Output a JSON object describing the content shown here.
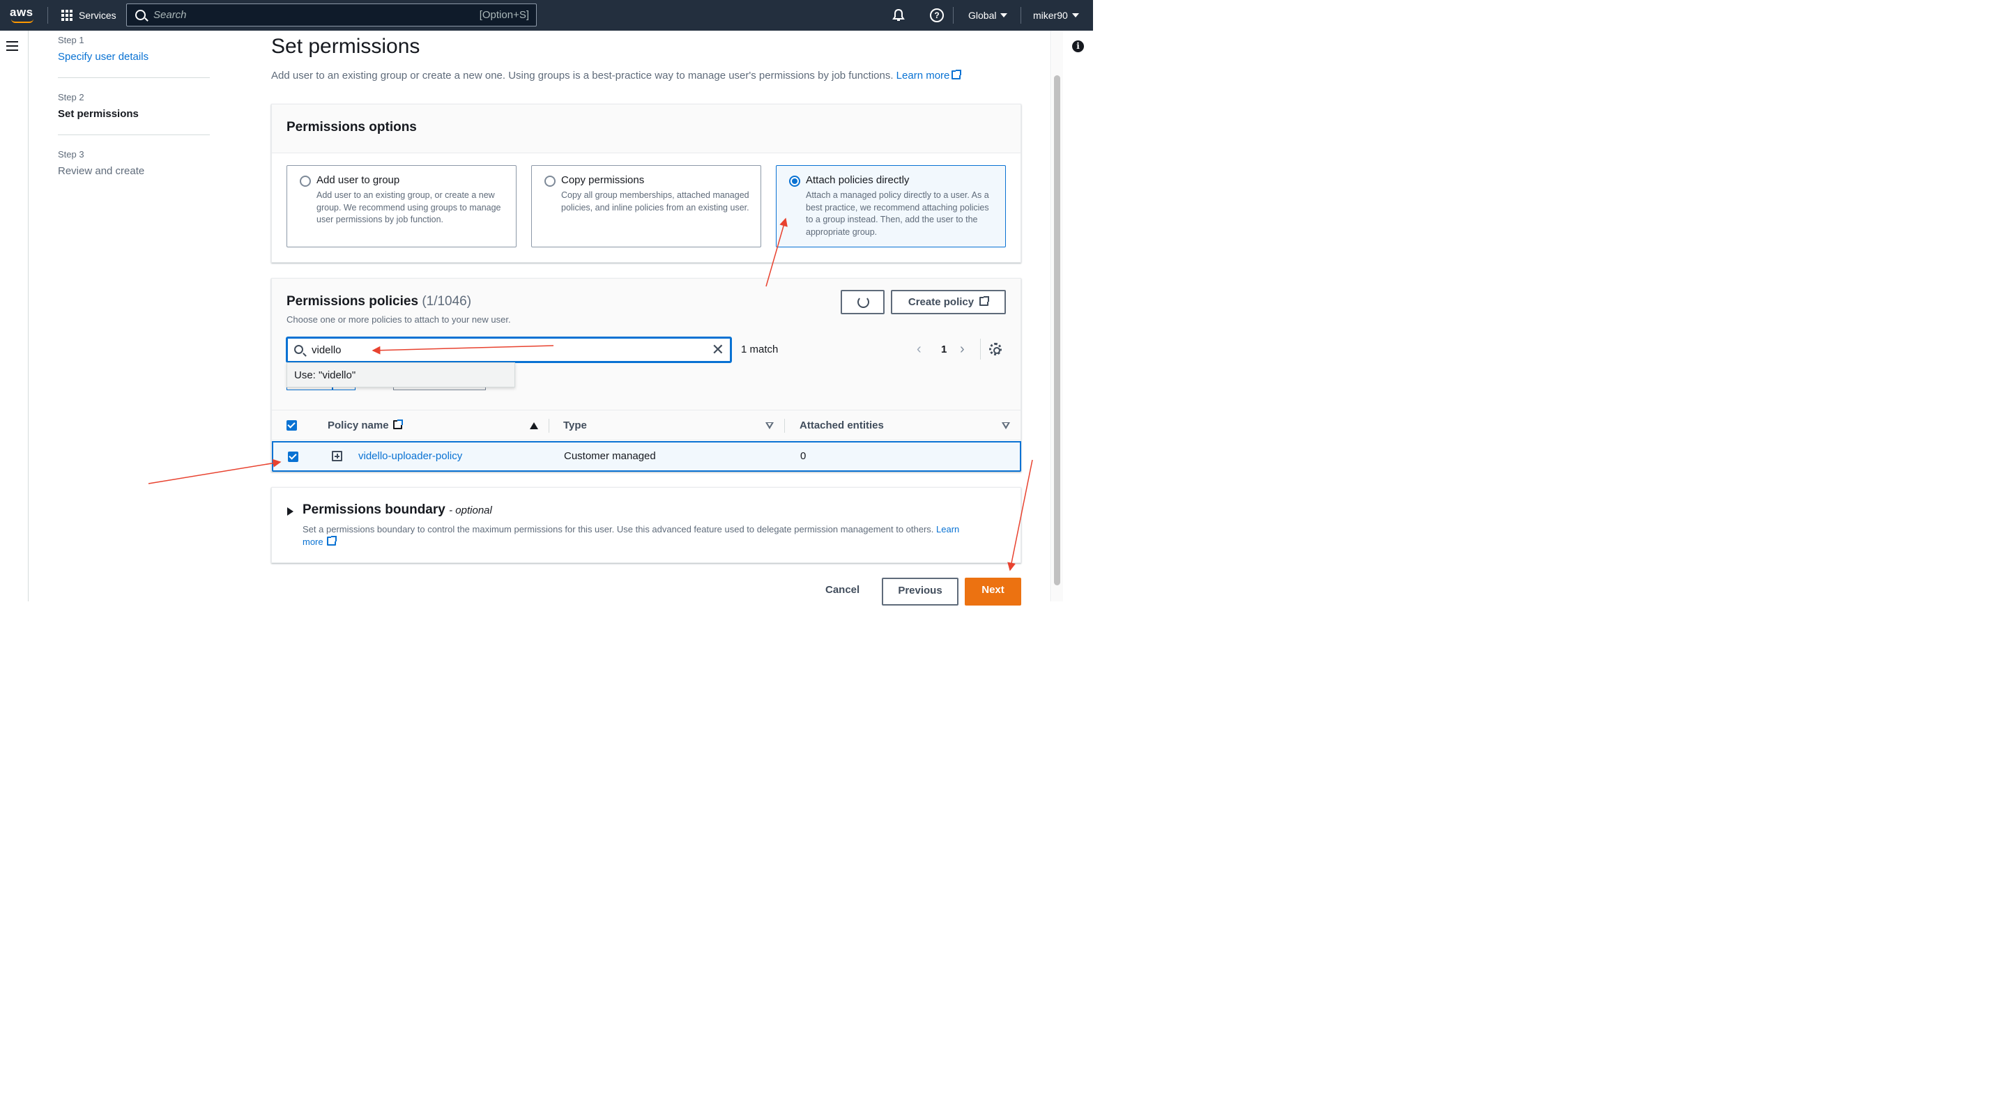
{
  "nav": {
    "logo": "aws",
    "services": "Services",
    "search_placeholder": "Search",
    "search_shortcut": "[Option+S]",
    "region": "Global",
    "user": "miker90"
  },
  "steps": [
    {
      "label": "Step 1",
      "title": "Specify user details"
    },
    {
      "label": "Step 2",
      "title": "Set permissions"
    },
    {
      "label": "Step 3",
      "title": "Review and create"
    }
  ],
  "page": {
    "title": "Set permissions",
    "description": "Add user to an existing group or create a new one. Using groups is a best-practice way to manage user's permissions by job functions.",
    "learn_more": "Learn more"
  },
  "permissions_options": {
    "title": "Permissions options",
    "tiles": [
      {
        "title": "Add user to group",
        "desc": "Add user to an existing group, or create a new group. We recommend using groups to manage user permissions by job function.",
        "selected": false
      },
      {
        "title": "Copy permissions",
        "desc": "Copy all group memberships, attached managed policies, and inline policies from an existing user.",
        "selected": false
      },
      {
        "title": "Attach policies directly",
        "desc": "Attach a managed policy directly to a user. As a best practice, we recommend attaching policies to a group instead. Then, add the user to the appropriate group.",
        "selected": true
      }
    ]
  },
  "permissions_policies": {
    "title": "Permissions policies",
    "count": "(1/1046)",
    "description": "Choose one or more policies to attach to your new user.",
    "create_policy": "Create policy",
    "filter_value": "vidello",
    "match": "1 match",
    "page": "1",
    "dropdown_option": "Use: \"vidello\"",
    "columns": [
      "Policy name",
      "Type",
      "Attached entities"
    ],
    "rows": [
      {
        "policy_name": "vidello-uploader-policy",
        "type": "Customer managed",
        "attached_entities": "0",
        "checked": true
      }
    ]
  },
  "permissions_boundary": {
    "title": "Permissions boundary",
    "optional": "- optional",
    "description": "Set a permissions boundary to control the maximum permissions for this user. Use this advanced feature used to delegate permission management to others.",
    "learn": "Learn",
    "more": "more"
  },
  "footer": {
    "cancel": "Cancel",
    "previous": "Previous",
    "next": "Next"
  },
  "colors": {
    "nav_bg": "#232f3e",
    "link": "#0972d3",
    "primary": "#ec7211",
    "annotation": "#e8422f"
  }
}
